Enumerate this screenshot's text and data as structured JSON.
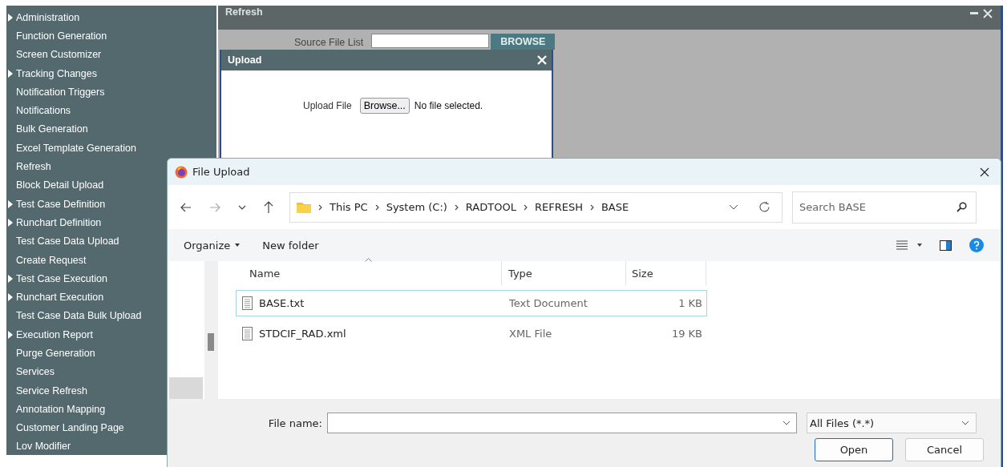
{
  "sidebar": {
    "items": [
      {
        "label": "Administration",
        "expandable": true
      },
      {
        "label": "Function Generation",
        "expandable": false
      },
      {
        "label": "Screen Customizer",
        "expandable": false
      },
      {
        "label": "Tracking Changes",
        "expandable": true
      },
      {
        "label": "Notification Triggers",
        "expandable": false
      },
      {
        "label": "Notifications",
        "expandable": false
      },
      {
        "label": "Bulk Generation",
        "expandable": false
      },
      {
        "label": "Excel Template Generation",
        "expandable": false
      },
      {
        "label": "Refresh",
        "expandable": false
      },
      {
        "label": "Block Detail Upload",
        "expandable": false
      },
      {
        "label": "Test Case Definition",
        "expandable": true
      },
      {
        "label": "Runchart Definition",
        "expandable": true
      },
      {
        "label": "Test Case Data Upload",
        "expandable": false
      },
      {
        "label": "Create Request",
        "expandable": false
      },
      {
        "label": "Test Case Execution",
        "expandable": true
      },
      {
        "label": "Runchart Execution",
        "expandable": true
      },
      {
        "label": "Test Case Data Bulk Upload",
        "expandable": false
      },
      {
        "label": "Execution Report",
        "expandable": true
      },
      {
        "label": "Purge Generation",
        "expandable": false
      },
      {
        "label": "Services",
        "expandable": false
      },
      {
        "label": "Service Refresh",
        "expandable": false
      },
      {
        "label": "Annotation Mapping",
        "expandable": false
      },
      {
        "label": "Customer Landing Page",
        "expandable": false
      },
      {
        "label": "Lov Modifier",
        "expandable": false
      }
    ]
  },
  "refresh_panel": {
    "title": "Refresh",
    "source_label": "Source File List",
    "browse_button": "BROWSE"
  },
  "upload_dialog": {
    "title": "Upload",
    "field_label": "Upload File",
    "browse_button": "Browse...",
    "file_status": "No file selected."
  },
  "file_dialog": {
    "title": "File Upload",
    "breadcrumbs": [
      "This PC",
      "System (C:)",
      "RADTOOL",
      "REFRESH",
      "BASE"
    ],
    "search": {
      "placeholder": "Search BASE"
    },
    "organize": "Organize",
    "new_folder": "New folder",
    "columns": [
      "Name",
      "Type",
      "Size"
    ],
    "files": [
      {
        "name": "BASE.txt",
        "type": "Text Document",
        "size": "1 KB",
        "selected": true
      },
      {
        "name": "STDCIF_RAD.xml",
        "type": "XML File",
        "size": "19 KB",
        "selected": false
      }
    ],
    "file_name_label": "File name:",
    "file_type": "All Files (*.*)",
    "buttons": [
      {
        "label": "Open",
        "default": true
      },
      {
        "label": "Cancel",
        "default": false
      }
    ]
  }
}
